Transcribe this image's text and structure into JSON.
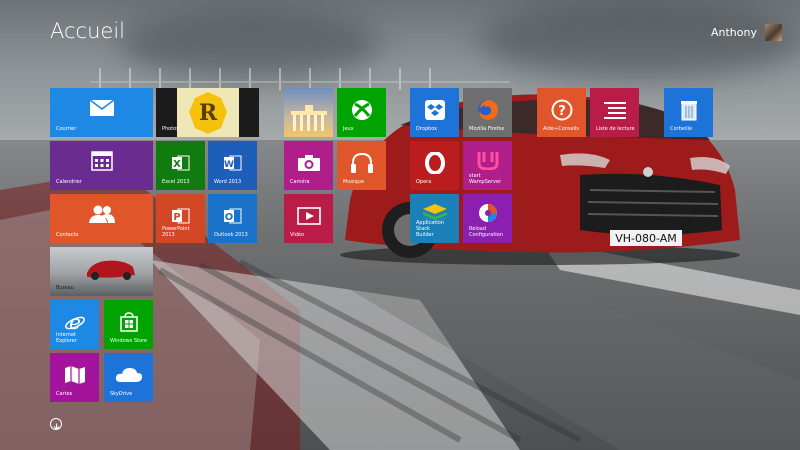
{
  "header": {
    "title": "Accueil",
    "user_name": "Anthony"
  },
  "colors": {
    "blue": "#1e88e5",
    "darkblue": "#1565c0",
    "purple": "#6a2c91",
    "orange": "#e0552a",
    "green": "#00a300",
    "magenta": "#b01e89",
    "red": "#b91d47",
    "grey": "#6e6e6e"
  },
  "tiles": {
    "courrier": {
      "label": "Courrier",
      "icon": "mail-icon"
    },
    "photos": {
      "label": "Photos",
      "icon": "photo-tile-icon",
      "badge": "R"
    },
    "calendrier": {
      "label": "Calendrier",
      "icon": "calendar-icon"
    },
    "excel": {
      "label": "Excel 2013",
      "icon": "excel-icon"
    },
    "word": {
      "label": "Word 2013",
      "icon": "word-icon"
    },
    "contacts": {
      "label": "Contacts",
      "icon": "people-icon"
    },
    "powerpoint": {
      "label": "PowerPoint 2013",
      "icon": "powerpoint-icon"
    },
    "outlook": {
      "label": "Outlook 2013",
      "icon": "outlook-icon"
    },
    "bureau": {
      "label": "Bureau",
      "icon": "desktop-icon"
    },
    "ie": {
      "label": "Internet Explorer",
      "icon": "ie-icon"
    },
    "store": {
      "label": "Windows Store",
      "icon": "store-icon"
    },
    "cartes": {
      "label": "Cartes",
      "icon": "map-icon"
    },
    "skydrive": {
      "label": "SkyDrive",
      "icon": "cloud-icon"
    },
    "landmark": {
      "label": "",
      "icon": "landmark-photo-icon"
    },
    "jeux": {
      "label": "Jeux",
      "icon": "xbox-icon"
    },
    "camera": {
      "label": "Caméra",
      "icon": "camera-icon"
    },
    "musique": {
      "label": "Musique",
      "icon": "headphones-icon"
    },
    "video": {
      "label": "Vidéo",
      "icon": "video-icon"
    },
    "dropbox": {
      "label": "Dropbox",
      "icon": "dropbox-icon"
    },
    "firefox": {
      "label": "Mozilla Firefox",
      "icon": "firefox-icon"
    },
    "aide": {
      "label": "Aide+Conseils",
      "icon": "help-icon"
    },
    "lecture": {
      "label": "Liste de lecture",
      "icon": "reading-list-icon"
    },
    "corbeille": {
      "label": "Corbeille",
      "icon": "recycle-bin-icon"
    },
    "opera": {
      "label": "Opera",
      "icon": "opera-icon"
    },
    "wamp": {
      "label": "start\nWampServer",
      "icon": "wamp-icon"
    },
    "appstack": {
      "label": "Application Stack\nBuilder",
      "icon": "stack-builder-icon"
    },
    "reload": {
      "label": "Reload\nConfiguration",
      "icon": "reload-config-icon"
    }
  },
  "background": {
    "plate": "VH-080-AM"
  }
}
